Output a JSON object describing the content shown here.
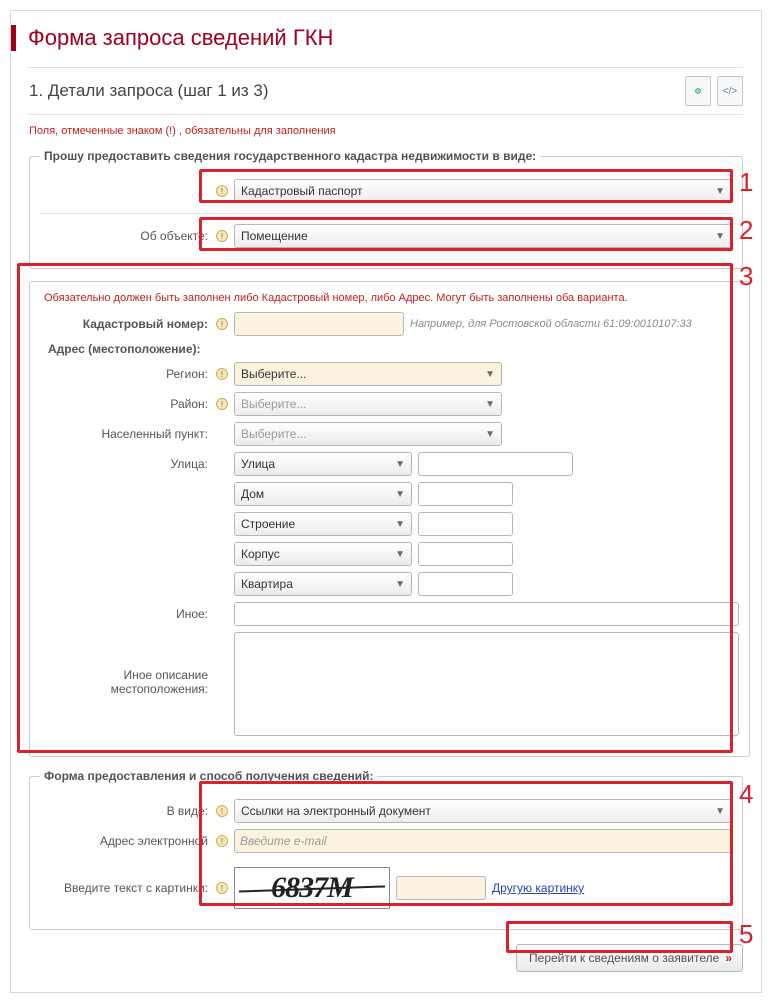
{
  "page_title": "Форма запроса сведений ГКН",
  "step": {
    "title": "1. Детали запроса (шаг 1 из 3)"
  },
  "required_note": "Поля, отмеченные знаком (!) , обязательны для заполнения",
  "group1": {
    "legend": "Прошу предоставить сведения государственного кадастра недвижимости в виде:",
    "doc_type_value": "Кадастровый паспорт",
    "object_label": "Об объекте:",
    "object_value": "Помещение"
  },
  "object_block": {
    "warn": "Обязательно должен быть заполнен либо Кадастровый номер, либо Адрес. Могут быть заполнены оба варианта.",
    "kad_label": "Кадастровый номер:",
    "kad_hint": "Например, для Ростовской области 61:09:0010107:33",
    "addr_title": "Адрес (местоположение):",
    "region_label": "Регион:",
    "region_value": "Выберите...",
    "rayon_label": "Район:",
    "rayon_value": "Выберите...",
    "np_label": "Населенный пункт:",
    "np_value": "Выберите...",
    "street_label": "Улица:",
    "street_value": "Улица",
    "house_value": "Дом",
    "build_value": "Строение",
    "korpus_value": "Корпус",
    "flat_value": "Квартира",
    "other_label": "Иное:",
    "other_desc_label": "Иное описание местоположения:"
  },
  "delivery": {
    "legend": "Форма предоставления и способ получения сведений:",
    "format_label": "В виде:",
    "format_value": "Ссылки на электронный документ",
    "email_label": "Адрес электронной",
    "email_placeholder": "Введите e-mail"
  },
  "captcha": {
    "label": "Введите текст с картинки:",
    "image_text": "6837M",
    "reload": "Другую картинку"
  },
  "submit_label": "Перейти к сведениям о заявителе",
  "annotations": {
    "n1": "1",
    "n2": "2",
    "n3": "3",
    "n4": "4",
    "n5": "5"
  }
}
